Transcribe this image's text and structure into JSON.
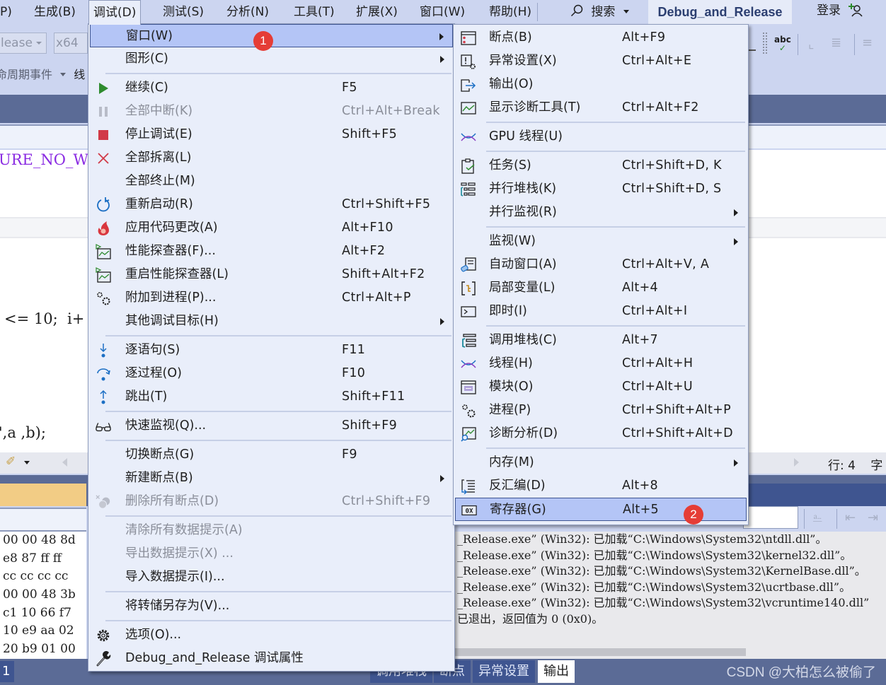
{
  "menubar": {
    "items": [
      {
        "label": "P)"
      },
      {
        "label": "生成(B)"
      },
      {
        "label": "调试(D)"
      },
      {
        "label": "测试(S)"
      },
      {
        "label": "分析(N)"
      },
      {
        "label": "工具(T)"
      },
      {
        "label": "扩展(X)"
      },
      {
        "label": "窗口(W)"
      },
      {
        "label": "帮助(H)"
      }
    ],
    "search_label": "搜索",
    "solution_name": "Debug_and_Release",
    "login_label": "登录"
  },
  "toolbar": {
    "config_value": "lease",
    "platform_value": "x64",
    "event_label": "命周期事件",
    "thread_label": "线"
  },
  "editor": {
    "lines": [
      "URE_NO_WAR",
      "<= 10;  i+",
      "\",a ,b);"
    ],
    "row_indicator": "行: 4",
    "col_indicator": "字"
  },
  "debug_menu": {
    "items": [
      {
        "label": "窗口(W)",
        "shortcut": "",
        "submenu": true,
        "highlighted": true,
        "icon": "none"
      },
      {
        "label": "图形(C)",
        "shortcut": "",
        "submenu": true,
        "icon": "none"
      },
      {
        "separator": true
      },
      {
        "label": "继续(C)",
        "shortcut": "F5",
        "icon": "play-icon"
      },
      {
        "label": "全部中断(K)",
        "shortcut": "Ctrl+Alt+Break",
        "disabled": true,
        "icon": "pause-icon"
      },
      {
        "label": "停止调试(E)",
        "shortcut": "Shift+F5",
        "icon": "stop-icon"
      },
      {
        "label": "全部拆离(L)",
        "shortcut": "",
        "icon": "detach-icon"
      },
      {
        "label": "全部终止(M)",
        "shortcut": "",
        "icon": "none"
      },
      {
        "label": "重新启动(R)",
        "shortcut": "Ctrl+Shift+F5",
        "icon": "restart-icon"
      },
      {
        "label": "应用代码更改(A)",
        "shortcut": "Alt+F10",
        "icon": "hot-reload-icon"
      },
      {
        "label": "性能探查器(F)...",
        "shortcut": "Alt+F2",
        "icon": "profiler-icon"
      },
      {
        "label": "重启性能探查器(L)",
        "shortcut": "Shift+Alt+F2",
        "icon": "profiler-icon"
      },
      {
        "label": "附加到进程(P)...",
        "shortcut": "Ctrl+Alt+P",
        "icon": "gears-icon"
      },
      {
        "label": "其他调试目标(H)",
        "shortcut": "",
        "submenu": true,
        "icon": "none"
      },
      {
        "separator": true
      },
      {
        "label": "逐语句(S)",
        "shortcut": "F11",
        "icon": "step-into-icon"
      },
      {
        "label": "逐过程(O)",
        "shortcut": "F10",
        "icon": "step-over-icon"
      },
      {
        "label": "跳出(T)",
        "shortcut": "Shift+F11",
        "icon": "step-out-icon"
      },
      {
        "separator": true
      },
      {
        "label": "快速监视(Q)...",
        "shortcut": "Shift+F9",
        "icon": "glasses-icon"
      },
      {
        "separator": true
      },
      {
        "label": "切换断点(G)",
        "shortcut": "F9",
        "icon": "none"
      },
      {
        "label": "新建断点(B)",
        "shortcut": "",
        "submenu": true,
        "icon": "none"
      },
      {
        "label": "删除所有断点(D)",
        "shortcut": "Ctrl+Shift+F9",
        "disabled": true,
        "icon": "delete-breakpoints-icon"
      },
      {
        "separator": true
      },
      {
        "label": "清除所有数据提示(A)",
        "shortcut": "",
        "disabled": true,
        "icon": "none"
      },
      {
        "label": "导出数据提示(X) ...",
        "shortcut": "",
        "disabled": true,
        "icon": "none"
      },
      {
        "label": "导入数据提示(I)...",
        "shortcut": "",
        "icon": "none"
      },
      {
        "separator": true
      },
      {
        "label": "将转储另存为(V)...",
        "shortcut": "",
        "icon": "none"
      },
      {
        "separator": true
      },
      {
        "label": "选项(O)...",
        "shortcut": "",
        "icon": "gear-icon"
      },
      {
        "label": "Debug_and_Release 调试属性",
        "shortcut": "",
        "icon": "wrench-icon"
      }
    ]
  },
  "window_submenu": {
    "items": [
      {
        "label": "断点(B)",
        "shortcut": "Alt+F9",
        "icon": "breakpoints-window-icon"
      },
      {
        "label": "异常设置(X)",
        "shortcut": "Ctrl+Alt+E",
        "icon": "exception-settings-icon"
      },
      {
        "label": "输出(O)",
        "shortcut": "",
        "icon": "output-icon"
      },
      {
        "label": "显示诊断工具(T)",
        "shortcut": "Ctrl+Alt+F2",
        "icon": "diagnostic-tools-icon"
      },
      {
        "separator": true
      },
      {
        "label": "GPU 线程(U)",
        "shortcut": "",
        "icon": "gpu-threads-icon"
      },
      {
        "separator": true
      },
      {
        "label": "任务(S)",
        "shortcut": "Ctrl+Shift+D, K",
        "icon": "tasks-icon"
      },
      {
        "label": "并行堆栈(K)",
        "shortcut": "Ctrl+Shift+D, S",
        "icon": "parallel-stacks-icon"
      },
      {
        "label": "并行监视(R)",
        "shortcut": "",
        "submenu": true,
        "icon": "none"
      },
      {
        "separator": true
      },
      {
        "label": "监视(W)",
        "shortcut": "",
        "submenu": true,
        "icon": "none"
      },
      {
        "label": "自动窗口(A)",
        "shortcut": "Ctrl+Alt+V, A",
        "icon": "autos-icon"
      },
      {
        "label": "局部变量(L)",
        "shortcut": "Alt+4",
        "icon": "locals-icon"
      },
      {
        "label": "即时(I)",
        "shortcut": "Ctrl+Alt+I",
        "icon": "immediate-icon"
      },
      {
        "separator": true
      },
      {
        "label": "调用堆栈(C)",
        "shortcut": "Alt+7",
        "icon": "call-stack-icon"
      },
      {
        "label": "线程(H)",
        "shortcut": "Ctrl+Alt+H",
        "icon": "threads-icon"
      },
      {
        "label": "模块(O)",
        "shortcut": "Ctrl+Alt+U",
        "icon": "modules-icon"
      },
      {
        "label": "进程(P)",
        "shortcut": "Ctrl+Shift+Alt+P",
        "icon": "processes-icon"
      },
      {
        "label": "诊断分析(D)",
        "shortcut": "Ctrl+Shift+Alt+D",
        "icon": "diagnostic-analysis-icon"
      },
      {
        "separator": true
      },
      {
        "label": "内存(M)",
        "shortcut": "",
        "submenu": true,
        "icon": "none"
      },
      {
        "label": "反汇编(D)",
        "shortcut": "Alt+8",
        "icon": "disassembly-icon"
      },
      {
        "label": "寄存器(G)",
        "shortcut": "Alt+5",
        "highlighted": true,
        "icon": "registers-icon"
      }
    ]
  },
  "annotations": {
    "step1": "1",
    "step2": "2"
  },
  "memory_pane": {
    "lines": [
      "00 00 48 8d",
      "e8 87 ff ff",
      "cc cc cc cc",
      "00 00 48 3b",
      "c1 10 66 f7",
      "10 e9 aa 02",
      "20 b9 01 00"
    ]
  },
  "output_pane": {
    "lines": [
      "_Release.exe” (Win32): 已加载“C:\\Windows\\System32\\ntdll.dll”。",
      "_Release.exe” (Win32): 已加载“C:\\Windows\\System32\\kernel32.dll”。",
      "_Release.exe” (Win32): 已加载“C:\\Windows\\System32\\KernelBase.dll”。",
      "_Release.exe” (Win32): 已加载“C:\\Windows\\System32\\ucrtbase.dll”。",
      "_Release.exe” (Win32): 已加载“C:\\Windows\\System32\\vcruntime140.dll”",
      "已退出，返回值为 0 (0x0)。"
    ]
  },
  "bottom_tabs": [
    {
      "label": "调用堆栈"
    },
    {
      "label": "断点"
    },
    {
      "label": "异常设置"
    },
    {
      "label": "输出",
      "selected": true
    }
  ],
  "bottom_line_badge": "1",
  "watermark": "CSDN @大柏怎么被偷了"
}
